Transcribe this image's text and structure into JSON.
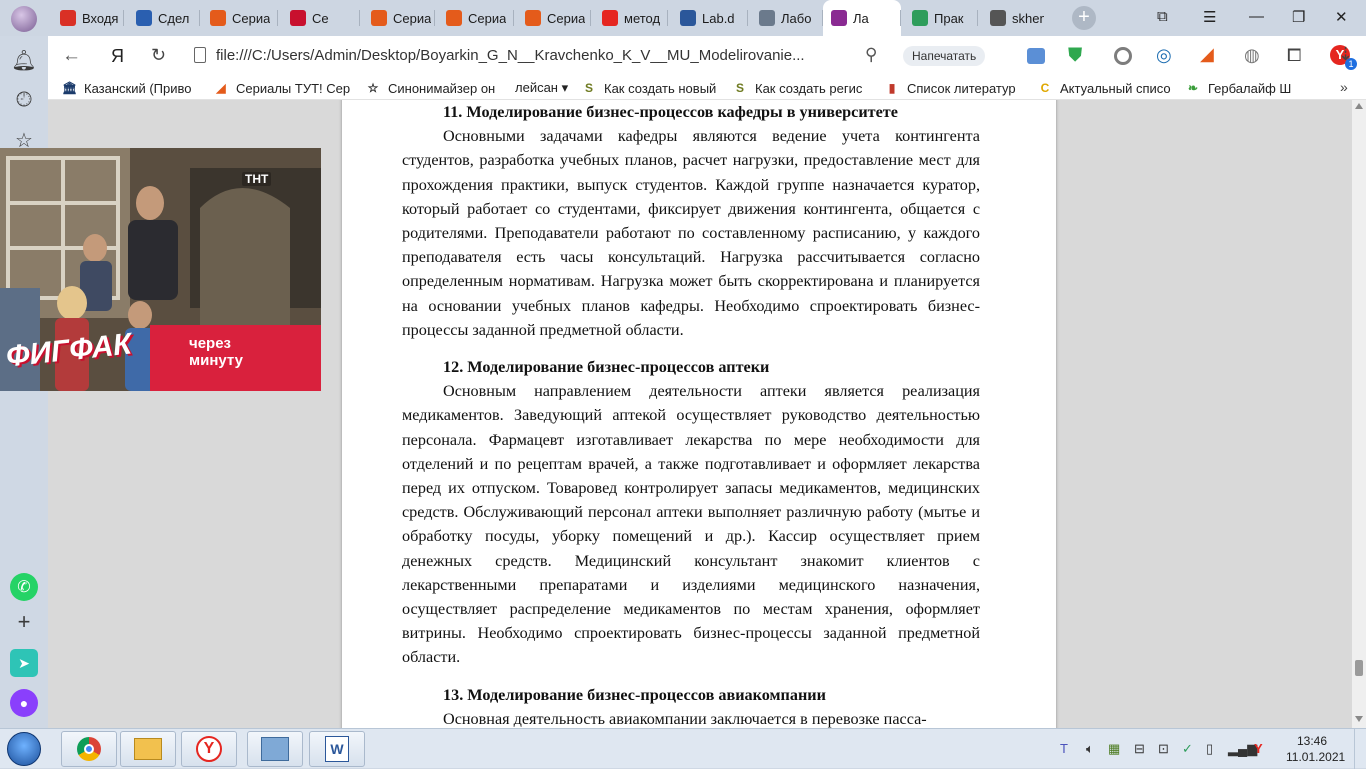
{
  "tabs": [
    {
      "title": "Входя",
      "icon": "gmail-icon",
      "color": "#d93025"
    },
    {
      "title": "Сдел",
      "icon": "24-icon",
      "color": "#2a5fb0"
    },
    {
      "title": "Сериа",
      "icon": "fox-icon",
      "color": "#e45b1b"
    },
    {
      "title": "Се",
      "icon": "red-book-icon",
      "color": "#c8102e"
    },
    {
      "title": "Сериа",
      "icon": "fox-icon",
      "color": "#e45b1b"
    },
    {
      "title": "Сериа",
      "icon": "fox-icon",
      "color": "#e45b1b"
    },
    {
      "title": "Сериа",
      "icon": "fox-icon",
      "color": "#e45b1b"
    },
    {
      "title": "метод",
      "icon": "yandex-icon",
      "color": "#e52620"
    },
    {
      "title": "Lab.d",
      "icon": "document-icon",
      "color": "#2b579a"
    },
    {
      "title": "Лабо",
      "icon": "globe-icon",
      "color": "#6b7a8c"
    },
    {
      "title": "Ла",
      "icon": "pdf-icon",
      "color": "#8a2a92",
      "active": true
    },
    {
      "title": "Прак",
      "icon": "check-icon",
      "color": "#2e9d5b"
    },
    {
      "title": "skhem",
      "icon": "file-icon",
      "color": "#555555"
    }
  ],
  "address": {
    "url": "file:///C:/Users/Admin/Desktop/Boyarkin_G_N__Kravchenko_K_V__MU_Modelirovanie...",
    "print_label": "Напечатать",
    "yandex_label": "Я",
    "notification_count": "1"
  },
  "bookmarks": [
    {
      "label": "Казанский (Приво",
      "icon": "bank-icon",
      "glyph": "🏛",
      "color": "#1b3b6b"
    },
    {
      "label": "Сериалы ТУТ! Сер",
      "icon": "fox-icon",
      "glyph": "◢",
      "color": "#e45b1b"
    },
    {
      "label": "Синонимайзер он",
      "icon": "star-icon",
      "glyph": "☆",
      "color": "#222222"
    },
    {
      "label": "лейсан ▾",
      "icon": "",
      "glyph": "",
      "color": "#222222"
    },
    {
      "label": "Как создать новый",
      "icon": "s-logo-icon",
      "glyph": "S",
      "color": "#6f7b22"
    },
    {
      "label": "Как создать регис",
      "icon": "s-logo-icon",
      "glyph": "S",
      "color": "#6f7b22"
    },
    {
      "label": "Список литератур",
      "icon": "book-icon",
      "glyph": "▮",
      "color": "#c0392b"
    },
    {
      "label": "Актуальный списо",
      "icon": "c-logo-icon",
      "glyph": "C",
      "color": "#e0a800"
    },
    {
      "label": "Гербалайф Ш",
      "icon": "leaf-icon",
      "glyph": "❧",
      "color": "#3a9d3a"
    }
  ],
  "video": {
    "badge": "ТНТ",
    "logo": "ФИГФАК",
    "promo": "через минуту",
    "promo_line1": "через",
    "promo_line2": "минуту"
  },
  "document": {
    "sections": [
      {
        "heading": "11. Моделирование бизнес-процессов кафедры в университете",
        "body": "Основными задачами кафедры являются ведение учета контингента студентов, разработка учебных планов, расчет нагрузки, предоставление мест для прохождения практики, выпуск студентов. Каждой группе назначается куратор, который работает со студентами, фиксирует движения контингента, общается с родителями. Преподаватели работают по составленному расписанию, у каждого преподавателя есть часы консультаций. Нагрузка рассчитывается согласно определенным нормативам. Нагрузка может быть скорректирована и планируется на основании учебных планов кафедры. Необходимо спроектировать бизнес-процессы заданной предметной области."
      },
      {
        "heading": "12. Моделирование бизнес-процессов аптеки",
        "body": "Основным направлением деятельности аптеки является реализация медикаментов. Заведующий аптекой осуществляет руководство деятельностью персонала. Фармацевт изготавливает лекарства по мере необходимости для отделений и по рецептам врачей, а также подготавливает и оформляет лекарства перед их отпуском. Товаровед контролирует запасы медикаментов, медицинских средств. Обслуживающий персонал аптеки выполняет различную работу (мытье и обработку посуды, уборку помещений и др.). Кассир осуществляет прием денежных средств. Медицинский консультант знакомит клиентов с лекарственными препаратами и изделиями медицинского назначения, осуществляет распределение медикаментов по местам хранения, оформляет витрины. Необходимо спроектировать бизнес-процессы заданной предметной области."
      },
      {
        "heading": "13. Моделирование бизнес-процессов авиакомпании",
        "body": "Основная деятельность авиакомпании заключается в перевозке пасса-"
      }
    ]
  },
  "taskbar": {
    "apps": [
      "chrome-icon",
      "explorer-icon",
      "yandex-browser-icon",
      "control-panel-icon",
      "word-icon"
    ],
    "time": "13:46",
    "date": "11.01.2021"
  }
}
